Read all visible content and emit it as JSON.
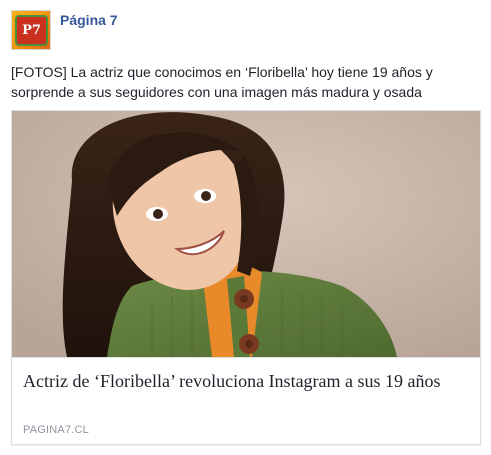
{
  "post": {
    "page_name": "Página 7",
    "avatar_text": "P7",
    "text": "[FOTOS] La actriz que conocimos en ‘Floribella’ hoy tiene 19 años y sorprende a sus seguidores con una imagen más madura y osada"
  },
  "link": {
    "title": "Actriz de ‘Floribella’ revoluciona Instagram a sus 19 años",
    "domain": "PAGINA7.CL"
  },
  "colors": {
    "page_name": "#365899",
    "text": "#1d2129",
    "domain": "#90949c",
    "border": "#dddfe2"
  },
  "icons": {
    "avatar": "pagina7-logo-icon"
  }
}
